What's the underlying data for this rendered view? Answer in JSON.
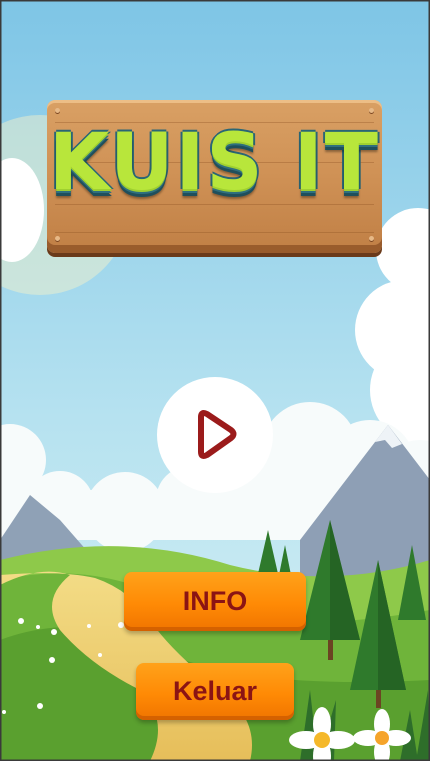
{
  "title": "KUIS IT",
  "buttons": {
    "play_icon": "play-icon",
    "info_label": "INFO",
    "exit_label": "Keluar"
  },
  "colors": {
    "sky_top": "#7ec5e6",
    "sky_bottom": "#c9ebf2",
    "button_orange": "#ff8a05",
    "button_text": "#8b1414",
    "play_arrow": "#9b1b1b",
    "title_green": "#b8e63b",
    "title_outline": "#2a6675",
    "wood": "#cf9155"
  }
}
